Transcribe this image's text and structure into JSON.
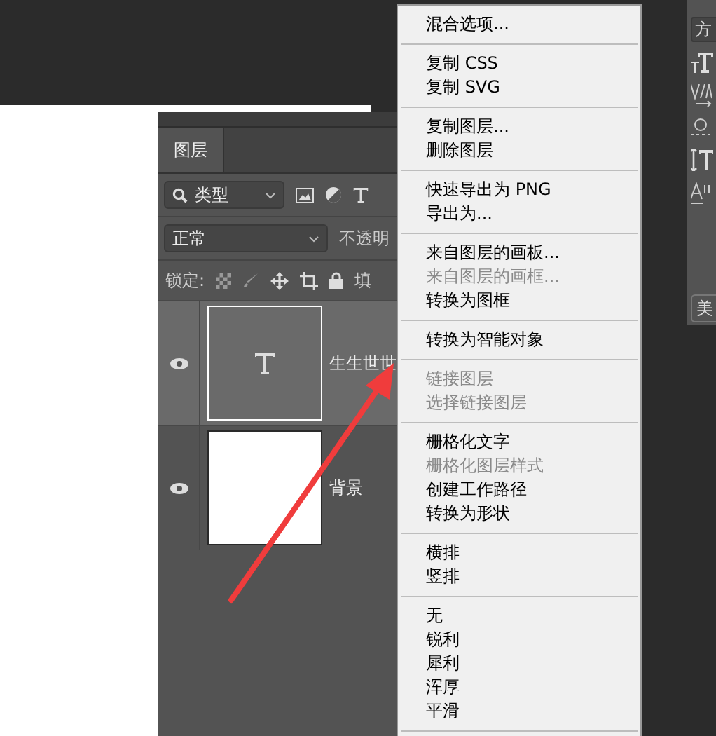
{
  "layers_panel": {
    "tab": {
      "label": "图层",
      "selected": true
    },
    "filter": {
      "value": "类型"
    },
    "blend_mode": {
      "value": "正常"
    },
    "opacity_label": "不透明",
    "lock_label": "锁定:",
    "fill_label": "填",
    "layers": [
      {
        "name": "生生世世",
        "kind": "text",
        "visible": true,
        "selected": true
      },
      {
        "name": "背景",
        "kind": "background",
        "visible": true,
        "selected": false
      }
    ]
  },
  "context_menu": {
    "groups": [
      [
        {
          "label": "混合选项...",
          "disabled": false
        }
      ],
      [
        {
          "label": "复制 CSS",
          "disabled": false
        },
        {
          "label": "复制 SVG",
          "disabled": false
        }
      ],
      [
        {
          "label": "复制图层...",
          "disabled": false
        },
        {
          "label": "删除图层",
          "disabled": false
        }
      ],
      [
        {
          "label": "快速导出为 PNG",
          "disabled": false
        },
        {
          "label": "导出为...",
          "disabled": false
        }
      ],
      [
        {
          "label": "来自图层的画板...",
          "disabled": false
        },
        {
          "label": "来自图层的画框...",
          "disabled": true
        },
        {
          "label": "转换为图框",
          "disabled": false
        }
      ],
      [
        {
          "label": "转换为智能对象",
          "disabled": false
        }
      ],
      [
        {
          "label": "链接图层",
          "disabled": true
        },
        {
          "label": "选择链接图层",
          "disabled": true
        }
      ],
      [
        {
          "label": "栅格化文字",
          "disabled": false
        },
        {
          "label": "栅格化图层样式",
          "disabled": true
        },
        {
          "label": "创建工作路径",
          "disabled": false
        },
        {
          "label": "转换为形状",
          "disabled": false
        }
      ],
      [
        {
          "label": "横排",
          "disabled": false
        },
        {
          "label": "竖排",
          "disabled": false
        }
      ],
      [
        {
          "label": "无",
          "disabled": false
        },
        {
          "label": "锐利",
          "disabled": false
        },
        {
          "label": "犀利",
          "disabled": false
        },
        {
          "label": "浑厚",
          "disabled": false
        },
        {
          "label": "平滑",
          "disabled": false
        }
      ]
    ]
  },
  "character_panel": {
    "font_style": "方",
    "button": "美"
  }
}
